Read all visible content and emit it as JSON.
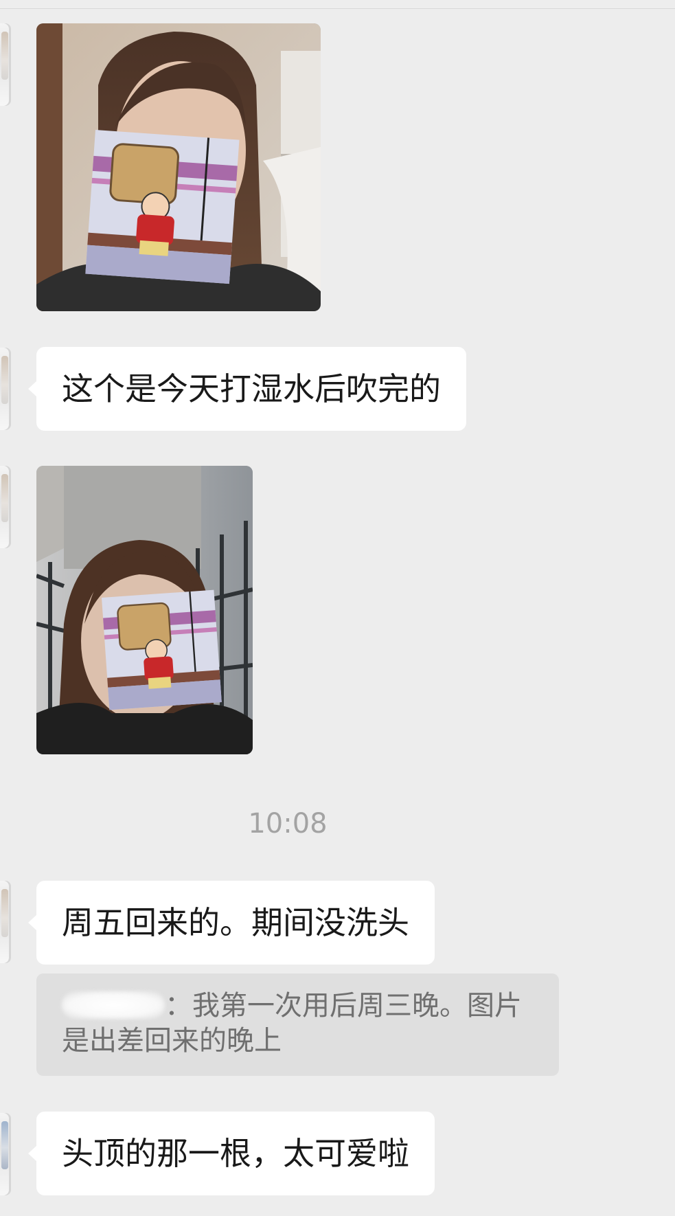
{
  "chat": {
    "messages": [
      {
        "type": "image",
        "description_icon": "photo-1"
      },
      {
        "type": "text",
        "text": "这个是今天打湿水后吹完的"
      },
      {
        "type": "image",
        "description_icon": "photo-2"
      },
      {
        "type": "text",
        "text": "周五回来的。期间没洗头"
      },
      {
        "type": "text",
        "text": "头顶的那一根，太可爱啦"
      }
    ],
    "timestamp": "10:08",
    "quote": {
      "separator": "：",
      "text": "我第一次用后周三晚。图片是出差回来的晚上"
    }
  },
  "colors": {
    "background": "#ededed",
    "bubble": "#ffffff",
    "quote_background": "#dfdfdf",
    "timestamp": "#a3a3a3"
  }
}
